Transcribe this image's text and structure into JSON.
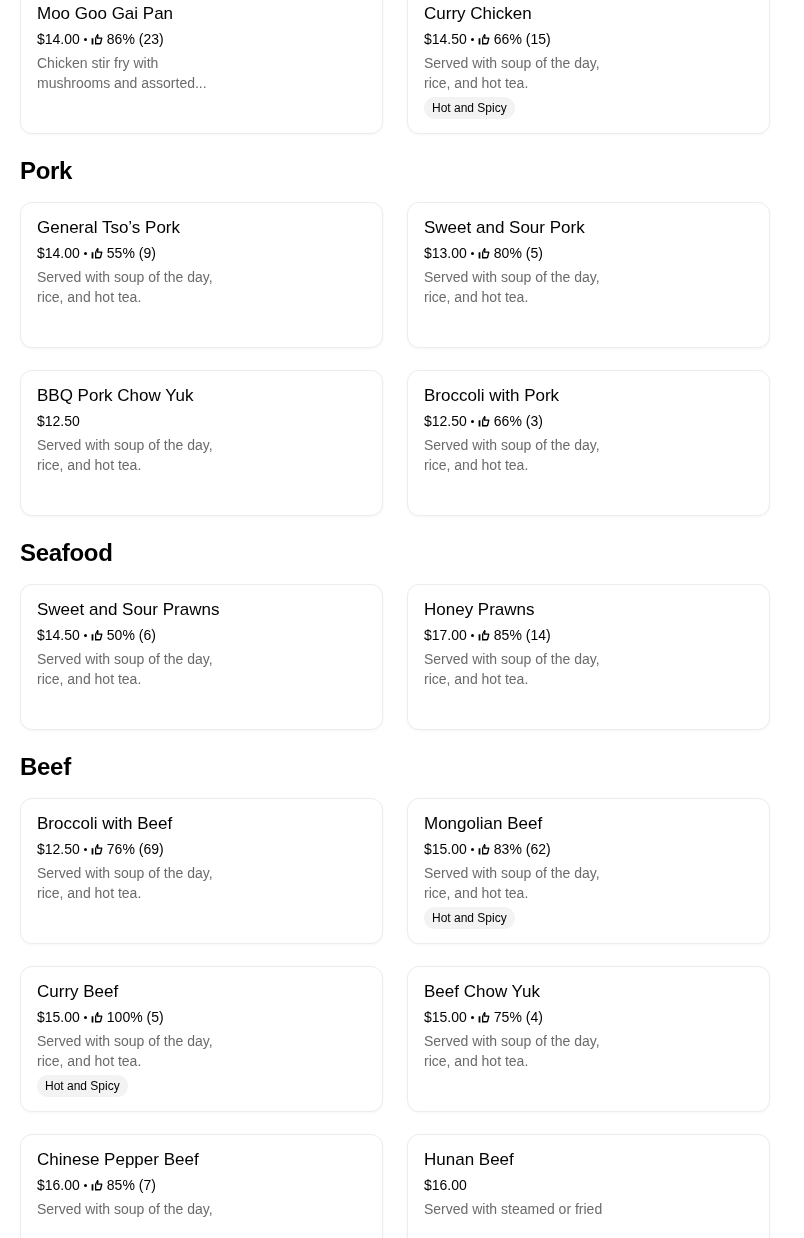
{
  "sections": [
    {
      "items": [
        {
          "name": "Moo Goo Gai Pan",
          "price": "$14.00",
          "rating": "86% (23)",
          "description": "Chicken stir fry with mushrooms and assorted..."
        },
        {
          "name": "Curry Chicken",
          "price": "$14.50",
          "rating": "66% (15)",
          "description": "Served with soup of the day, rice, and hot tea.",
          "tag": "Hot and Spicy"
        }
      ]
    },
    {
      "title": "Pork",
      "items": [
        {
          "name": "General Tso’s Pork",
          "price": "$14.00",
          "rating": "55% (9)",
          "description": "Served with soup of the day, rice, and hot tea."
        },
        {
          "name": "Sweet and Sour Pork",
          "price": "$13.00",
          "rating": "80% (5)",
          "description": "Served with soup of the day, rice, and hot tea."
        },
        {
          "name": "BBQ Pork Chow Yuk",
          "price": "$12.50",
          "description": "Served with soup of the day, rice, and hot tea."
        },
        {
          "name": "Broccoli with Pork",
          "price": "$12.50",
          "rating": "66% (3)",
          "description": "Served with soup of the day, rice, and hot tea."
        }
      ]
    },
    {
      "title": "Seafood",
      "items": [
        {
          "name": "Sweet and Sour Prawns",
          "price": "$14.50",
          "rating": "50% (6)",
          "description": "Served with soup of the day, rice, and hot tea."
        },
        {
          "name": "Honey Prawns",
          "price": "$17.00",
          "rating": "85% (14)",
          "description": "Served with soup of the day, rice, and hot tea."
        }
      ]
    },
    {
      "title": "Beef",
      "items": [
        {
          "name": "Broccoli with Beef",
          "price": "$12.50",
          "rating": "76% (69)",
          "description": "Served with soup of the day, rice, and hot tea."
        },
        {
          "name": "Mongolian Beef",
          "price": "$15.00",
          "rating": "83% (62)",
          "description": "Served with soup of the day, rice, and hot tea.",
          "tag": "Hot and Spicy"
        },
        {
          "name": "Curry Beef",
          "price": "$15.00",
          "rating": "100% (5)",
          "description": "Served with soup of the day, rice, and hot tea.",
          "tag": "Hot and Spicy"
        },
        {
          "name": "Beef Chow Yuk",
          "price": "$15.00",
          "rating": "75% (4)",
          "description": "Served with soup of the day, rice, and hot tea."
        },
        {
          "name": "Chinese Pepper Beef",
          "price": "$16.00",
          "rating": "85% (7)",
          "description": "Served with soup of the day,"
        },
        {
          "name": "Hunan Beef",
          "price": "$16.00",
          "description": "Served with steamed or fried"
        }
      ]
    }
  ]
}
